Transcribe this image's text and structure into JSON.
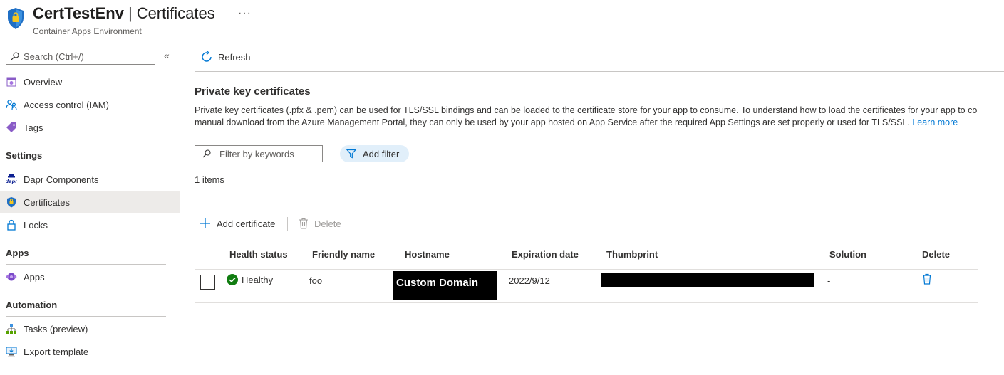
{
  "header": {
    "resource_name": "CertTestEnv",
    "separator": "|",
    "page_name": "Certificates",
    "more": "···",
    "subtitle": "Container Apps Environment"
  },
  "sidebar": {
    "search_placeholder": "Search (Ctrl+/)",
    "collapse": "«",
    "top_items": [
      {
        "label": "Overview",
        "icon": "overview-icon"
      },
      {
        "label": "Access control (IAM)",
        "icon": "people-icon"
      },
      {
        "label": "Tags",
        "icon": "tag-icon"
      }
    ],
    "sections": [
      {
        "title": "Settings",
        "items": [
          {
            "label": "Dapr Components",
            "icon": "dapr-icon"
          },
          {
            "label": "Certificates",
            "icon": "certificate-shield-icon",
            "active": true
          },
          {
            "label": "Locks",
            "icon": "lock-icon"
          }
        ]
      },
      {
        "title": "Apps",
        "items": [
          {
            "label": "Apps",
            "icon": "apps-icon"
          }
        ]
      },
      {
        "title": "Automation",
        "items": [
          {
            "label": "Tasks (preview)",
            "icon": "tasks-icon"
          },
          {
            "label": "Export template",
            "icon": "export-template-icon"
          }
        ]
      }
    ]
  },
  "toolbar": {
    "refresh_label": "Refresh"
  },
  "main": {
    "heading": "Private key certificates",
    "description_line1": "Private key certificates (.pfx & .pem) can be used for TLS/SSL bindings and can be loaded to the certificate store for your app to consume. To understand how to load the certificates for your app to co",
    "description_line2": "manual download from the Azure Management Portal, they can only be used by your app hosted on App Service after the required App Settings are set properly or used for TLS/SSL.",
    "learn_more": "Learn more",
    "filter_placeholder": "Filter by keywords",
    "add_filter_label": "Add filter",
    "items_count": "1 items",
    "add_certificate_label": "Add certificate",
    "delete_label": "Delete"
  },
  "table": {
    "columns": [
      "Health status",
      "Friendly name",
      "Hostname",
      "Expiration date",
      "Thumbprint",
      "Solution",
      "Delete"
    ],
    "rows": [
      {
        "health_status": "Healthy",
        "friendly_name": "foo",
        "hostname": "Custom Domain",
        "expiration_date": "2022/9/12",
        "thumbprint": "",
        "solution": "-"
      }
    ]
  },
  "colors": {
    "accent": "#0078d4",
    "healthy": "#107c10",
    "active_nav_bg": "#edebe9",
    "filter_pill_bg": "#e1effa"
  }
}
